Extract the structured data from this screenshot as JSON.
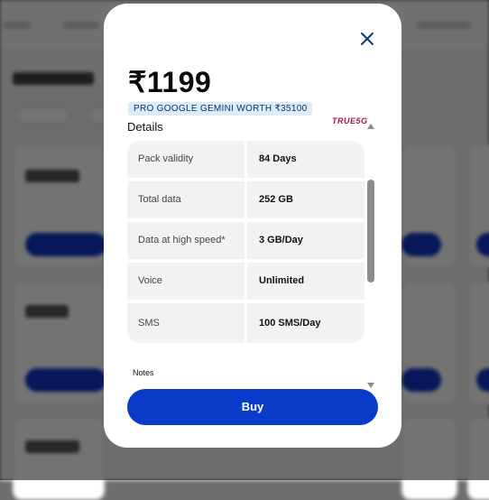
{
  "modal": {
    "price": "₹1199",
    "offer_tag": "PRO GOOGLE GEMINI WORTH ₹35100",
    "brand_logo": "TRUE5G",
    "details_title": "Details",
    "details": [
      {
        "label": "Pack validity",
        "value": "84 Days"
      },
      {
        "label": "Total data",
        "value": "252 GB"
      },
      {
        "label": "Data at high speed*",
        "value": "3 GB/Day"
      },
      {
        "label": "Voice",
        "value": "Unlimited"
      },
      {
        "label": "SMS",
        "value": "100 SMS/Day"
      }
    ],
    "notes_title": "Notes",
    "buy_label": "Buy",
    "close_icon": "close-icon"
  },
  "colors": {
    "buy_button": "#0b3cc9",
    "offer_tag_bg": "#dcecf6",
    "brand_logo": "#a0173a"
  }
}
